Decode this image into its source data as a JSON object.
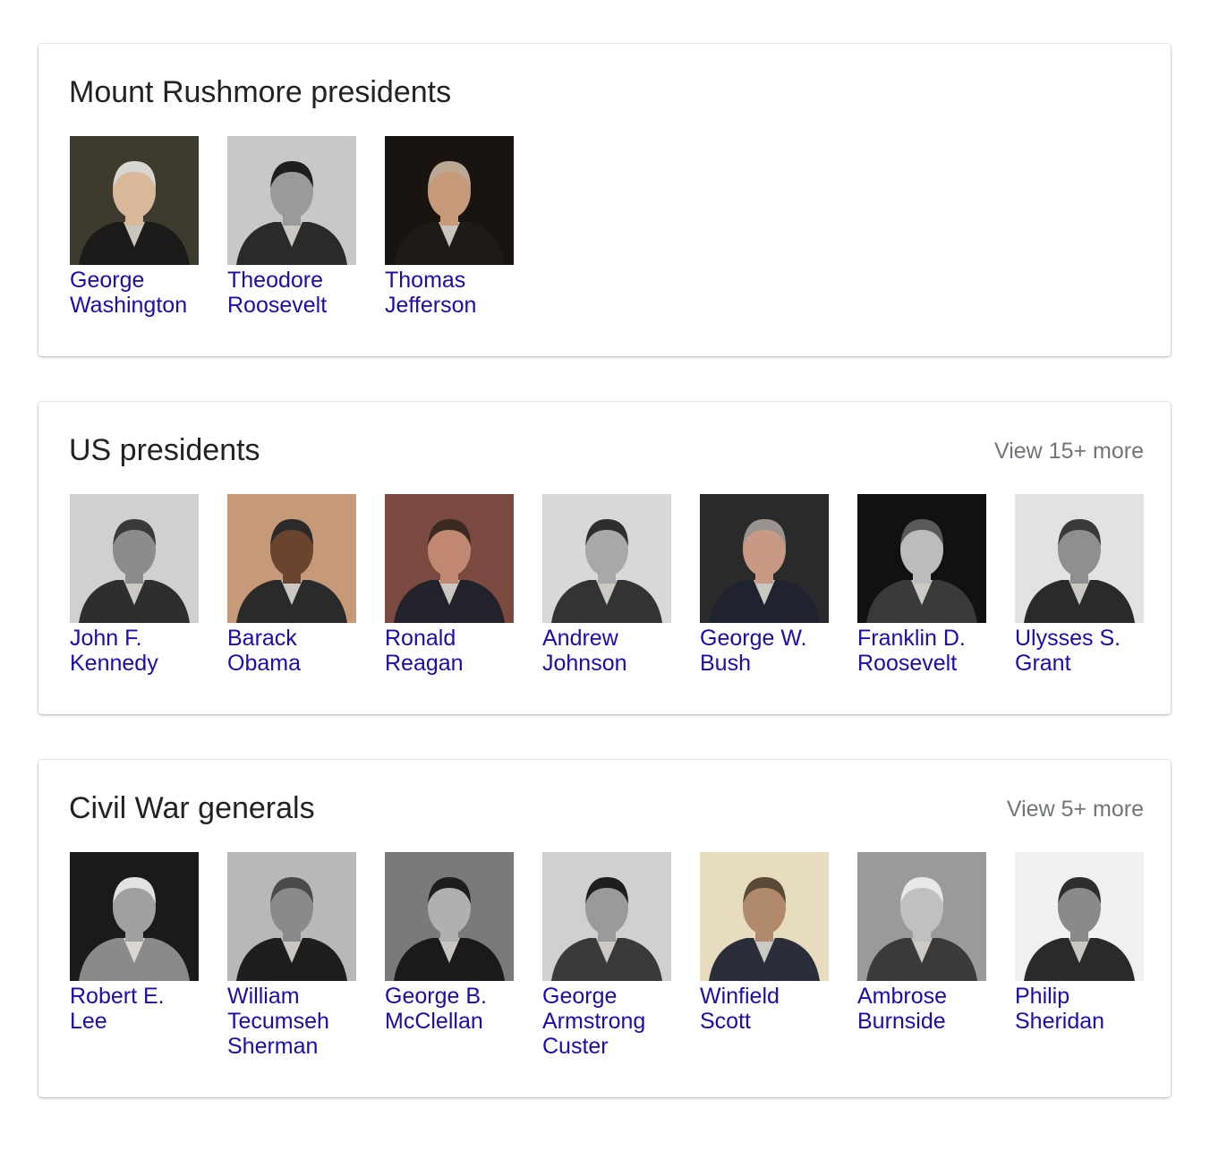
{
  "cards": [
    {
      "title": "Mount Rushmore presidents",
      "view_more": "",
      "items": [
        {
          "name": "George Washington",
          "bg": "#3d3a2e",
          "coat": "#1c1b1a",
          "skin": "#d9b89a",
          "hair": "#d8d6d0"
        },
        {
          "name": "Theodore Roosevelt",
          "bg": "#c8c8c8",
          "coat": "#2a2a2a",
          "skin": "#9a9a9a",
          "hair": "#1e1e1e"
        },
        {
          "name": "Thomas Jefferson",
          "bg": "#1a1410",
          "coat": "#1e1a16",
          "skin": "#c79a7a",
          "hair": "#bba892"
        }
      ]
    },
    {
      "title": "US presidents",
      "view_more": "View 15+ more",
      "items": [
        {
          "name": "John F. Kennedy",
          "bg": "#d0d0d0",
          "coat": "#2e2e2e",
          "skin": "#8c8c8c",
          "hair": "#3a3a3a"
        },
        {
          "name": "Barack Obama",
          "bg": "#c69a78",
          "coat": "#2a2a2a",
          "skin": "#6b4430",
          "hair": "#2a2a2a"
        },
        {
          "name": "Ronald Reagan",
          "bg": "#7a4a40",
          "coat": "#22222a",
          "skin": "#c08870",
          "hair": "#3a2a20"
        },
        {
          "name": "Andrew Johnson",
          "bg": "#d8d8d8",
          "coat": "#333333",
          "skin": "#a8a8a8",
          "hair": "#2e2e2e"
        },
        {
          "name": "George W. Bush",
          "bg": "#2a2a2a",
          "coat": "#1f2330",
          "skin": "#c89a86",
          "hair": "#9a9490"
        },
        {
          "name": "Franklin D. Roosevelt",
          "bg": "#111111",
          "coat": "#3a3a3a",
          "skin": "#bcbcbc",
          "hair": "#5a5a5a"
        },
        {
          "name": "Ulysses S. Grant",
          "bg": "#e2e2e2",
          "coat": "#2a2a2a",
          "skin": "#8f8f8f",
          "hair": "#3a3a3a"
        }
      ]
    },
    {
      "title": "Civil War generals",
      "view_more": "View 5+ more",
      "items": [
        {
          "name": "Robert E. Lee",
          "bg": "#1a1a1a",
          "coat": "#8a8a8a",
          "skin": "#a0a0a0",
          "hair": "#e2e2e2"
        },
        {
          "name": "William Tecumseh Sherman",
          "bg": "#b8b8b8",
          "coat": "#1e1e1e",
          "skin": "#8a8a8a",
          "hair": "#4a4a4a"
        },
        {
          "name": "George B. McClellan",
          "bg": "#7a7a7a",
          "coat": "#1a1a1a",
          "skin": "#b0b0b0",
          "hair": "#1e1e1e"
        },
        {
          "name": "George Armstrong Custer",
          "bg": "#d0d0d0",
          "coat": "#3a3a3a",
          "skin": "#9a9a9a",
          "hair": "#1e1e1e"
        },
        {
          "name": "Winfield Scott",
          "bg": "#e8dcc0",
          "coat": "#2a2e3a",
          "skin": "#b08a6a",
          "hair": "#5a4a38"
        },
        {
          "name": "Ambrose Burnside",
          "bg": "#9a9a9a",
          "coat": "#3a3a3a",
          "skin": "#c0c0c0",
          "hair": "#e8e8e8"
        },
        {
          "name": "Philip Sheridan",
          "bg": "#f0f0f0",
          "coat": "#2a2a2a",
          "skin": "#8a8a8a",
          "hair": "#2e2e2e"
        }
      ]
    }
  ]
}
